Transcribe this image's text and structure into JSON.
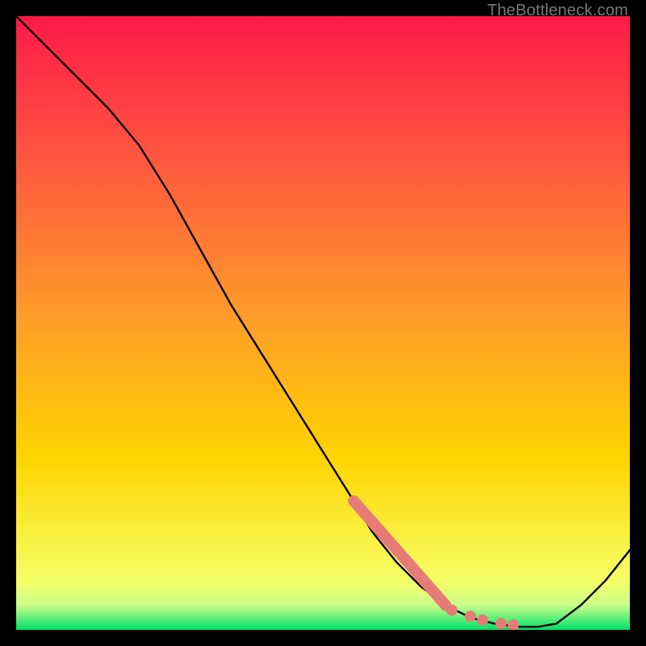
{
  "watermark": "TheBottleneck.com",
  "chart_data": {
    "type": "line",
    "title": "",
    "xlabel": "",
    "ylabel": "",
    "xlim": [
      0,
      100
    ],
    "ylim": [
      0,
      100
    ],
    "grid": false,
    "background_gradient": {
      "top_color": "#ff1a49",
      "mid_color": "#ffd400",
      "bottom_band_color": "#00e06a",
      "bottom_band_fraction": 0.04
    },
    "series": [
      {
        "name": "curve",
        "color": "#000000",
        "x": [
          0,
          5,
          10,
          15,
          20,
          25,
          30,
          35,
          40,
          45,
          50,
          55,
          58,
          62,
          66,
          70,
          74,
          78,
          82,
          85,
          88,
          92,
          96,
          100
        ],
        "y": [
          100,
          95,
          90,
          85,
          79,
          71,
          62,
          53,
          45,
          37,
          29,
          21,
          16,
          11,
          7,
          4,
          2,
          1,
          0.5,
          0.5,
          1,
          4,
          8,
          13
        ]
      }
    ],
    "highlight": {
      "name": "salmon-band",
      "color": "#e77b78",
      "segment": {
        "x": [
          55,
          70
        ],
        "y": [
          21,
          4
        ],
        "thickness_px": 14
      },
      "dots": [
        {
          "x": 71,
          "y": 3.2
        },
        {
          "x": 74,
          "y": 2.2
        },
        {
          "x": 76,
          "y": 1.6
        },
        {
          "x": 79,
          "y": 1.0
        },
        {
          "x": 81,
          "y": 0.8
        }
      ],
      "dot_radius_px": 7
    }
  }
}
